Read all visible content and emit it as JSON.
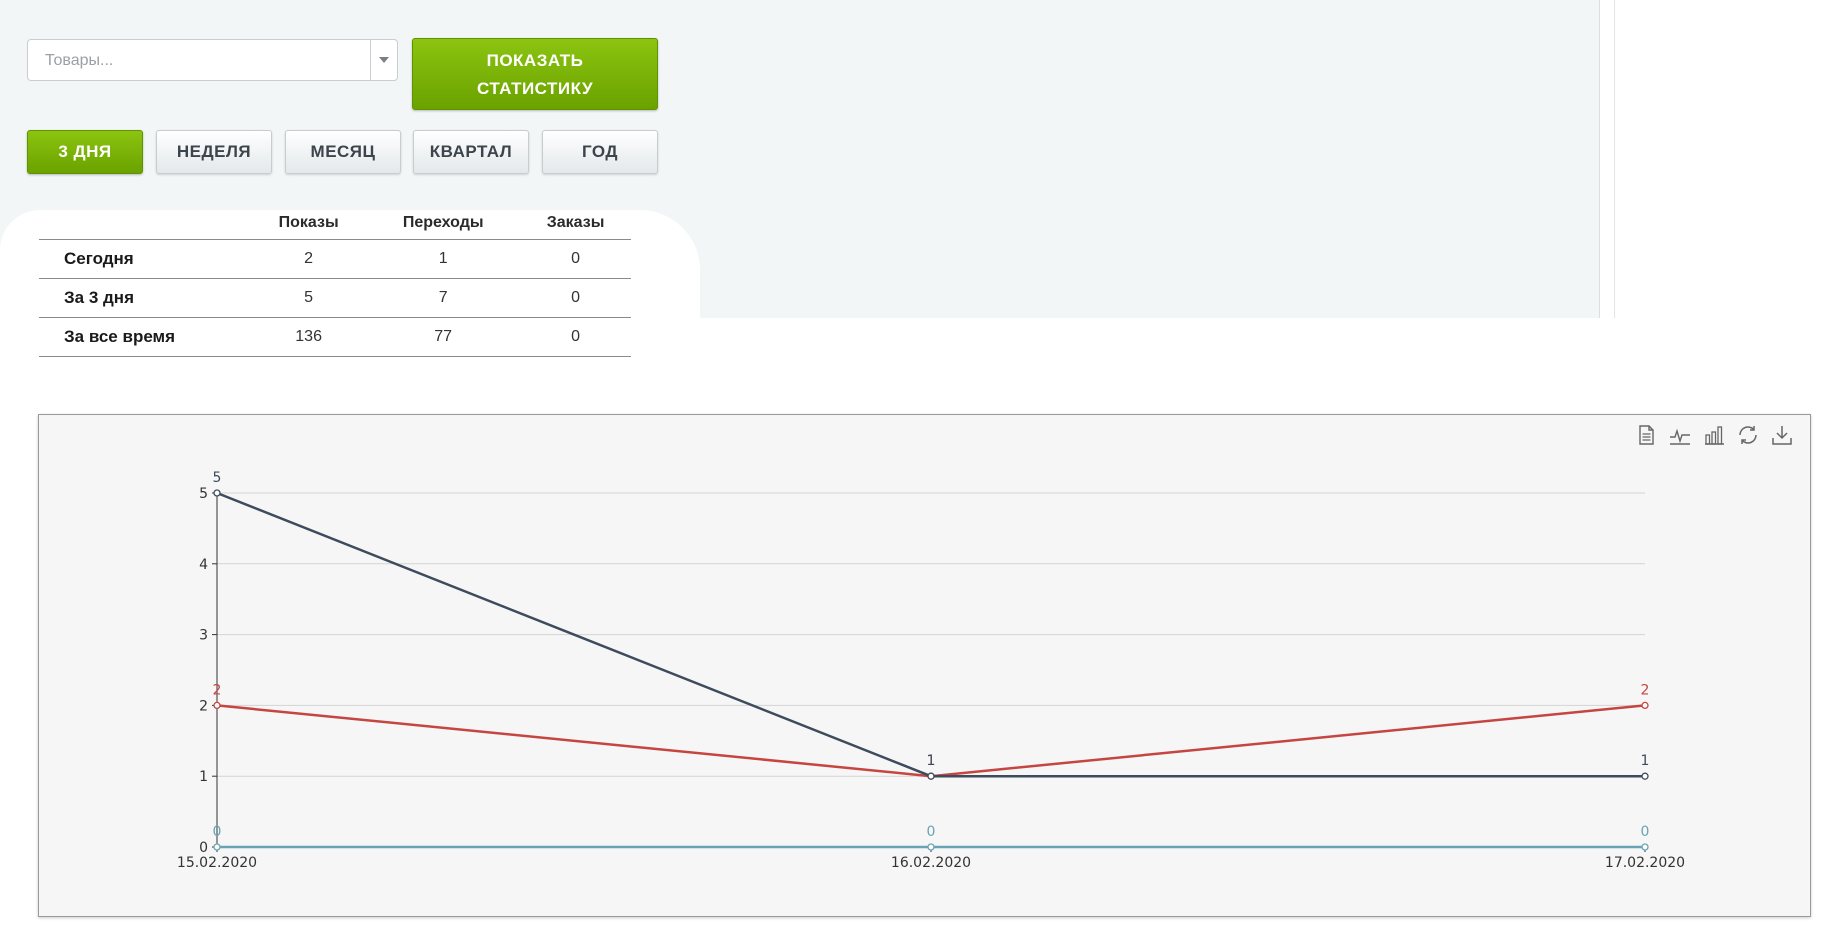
{
  "filter": {
    "products_placeholder": "Товары...",
    "show_button_line1": "ПОКАЗАТЬ",
    "show_button_line2": "СТАТИСТИКУ"
  },
  "periods": [
    {
      "label": "3 ДНЯ",
      "active": true
    },
    {
      "label": "НЕДЕЛЯ",
      "active": false
    },
    {
      "label": "МЕСЯЦ",
      "active": false
    },
    {
      "label": "КВАРТАЛ",
      "active": false
    },
    {
      "label": "ГОД",
      "active": false
    }
  ],
  "stats_table": {
    "columns": [
      "Показы",
      "Переходы",
      "Заказы"
    ],
    "rows": [
      {
        "label": "Сегодня",
        "values": [
          "2",
          "1",
          "0"
        ]
      },
      {
        "label": "За 3 дня",
        "values": [
          "5",
          "7",
          "0"
        ]
      },
      {
        "label": "За все время",
        "values": [
          "136",
          "77",
          "0"
        ]
      }
    ]
  },
  "toolbox": [
    "data-view-icon",
    "line-chart-icon",
    "bar-chart-icon",
    "restore-icon",
    "save-image-icon"
  ],
  "chart_data": {
    "type": "line",
    "x": [
      "15.02.2020",
      "16.02.2020",
      "17.02.2020"
    ],
    "series": [
      {
        "values": [
          5,
          1,
          1
        ],
        "color": "#3d4b5c"
      },
      {
        "values": [
          2,
          1,
          2
        ],
        "color": "#c64541"
      },
      {
        "values": [
          0,
          0,
          0
        ],
        "color": "#6aa3b4"
      }
    ],
    "yticks": [
      0,
      1,
      2,
      3,
      4,
      5
    ],
    "ylim": [
      0,
      5
    ],
    "grid": true
  }
}
